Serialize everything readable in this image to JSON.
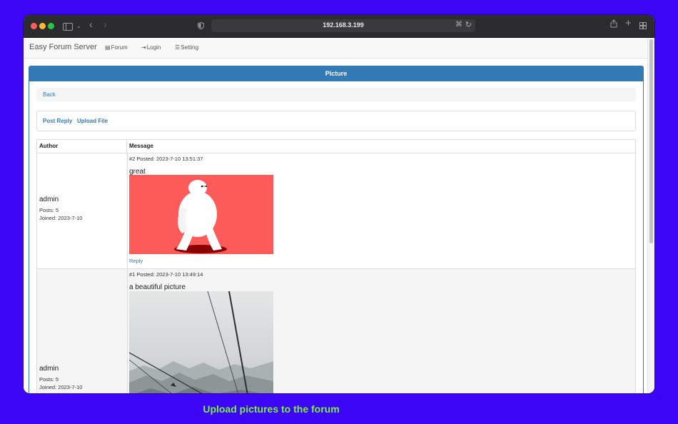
{
  "browser": {
    "url": "192.168.3.199"
  },
  "navbar": {
    "brand": "Easy Forum Server",
    "links": [
      {
        "label": "Forum",
        "icon": "list-icon"
      },
      {
        "label": "Login",
        "icon": "login-icon"
      },
      {
        "label": "Setting",
        "icon": "menu-icon"
      }
    ]
  },
  "panel": {
    "title": "Picture",
    "back_label": "Back",
    "post_reply_label": "Post Reply",
    "upload_file_label": "Upload File"
  },
  "table": {
    "headers": {
      "author": "Author",
      "message": "Message"
    },
    "posts": [
      {
        "author": "admin",
        "posts": "Posts: 5",
        "joined": "Joined: 2023-7-10",
        "posted": "#2 Posted: 2023-7-10 13:51:37",
        "text": "great",
        "reply_label": "Reply",
        "image": "baymax-image"
      },
      {
        "author": "admin",
        "posts": "Posts: 5",
        "joined": "Joined: 2023-7-10",
        "posted": "#1 Posted: 2023-7-10 13:49:14",
        "text": "a beautiful picture",
        "image": "cable-car-mountain-image"
      }
    ]
  },
  "caption": "Upload pictures to the forum",
  "colors": {
    "background": "#3d05f5",
    "primary": "#337ab7",
    "caption": "#7bf23d",
    "image1_background": "#fd5a5a"
  }
}
